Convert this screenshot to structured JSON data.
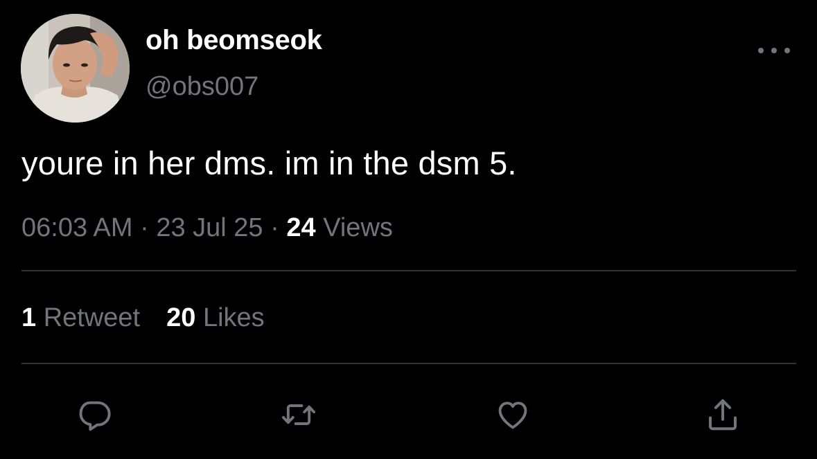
{
  "author": {
    "display_name": "oh beomseok",
    "handle": "@obs007",
    "avatar_icon": "profile-photo"
  },
  "tweet": {
    "text": "youre in her dms. im in the dsm 5."
  },
  "meta": {
    "time": "06:03 AM",
    "separator": "·",
    "date": "23 Jul 25",
    "views_count": "24",
    "views_label": "Views"
  },
  "stats": {
    "retweets_count": "1",
    "retweets_label": "Retweet",
    "likes_count": "20",
    "likes_label": "Likes"
  },
  "actions": {
    "reply_icon": "reply-icon",
    "retweet_icon": "retweet-icon",
    "like_icon": "heart-icon",
    "share_icon": "share-icon",
    "more_icon": "more-horizontal-icon"
  },
  "colors": {
    "background": "#000000",
    "primary_text": "#ffffff",
    "secondary_text": "#71767b",
    "divider": "#2f3336"
  }
}
